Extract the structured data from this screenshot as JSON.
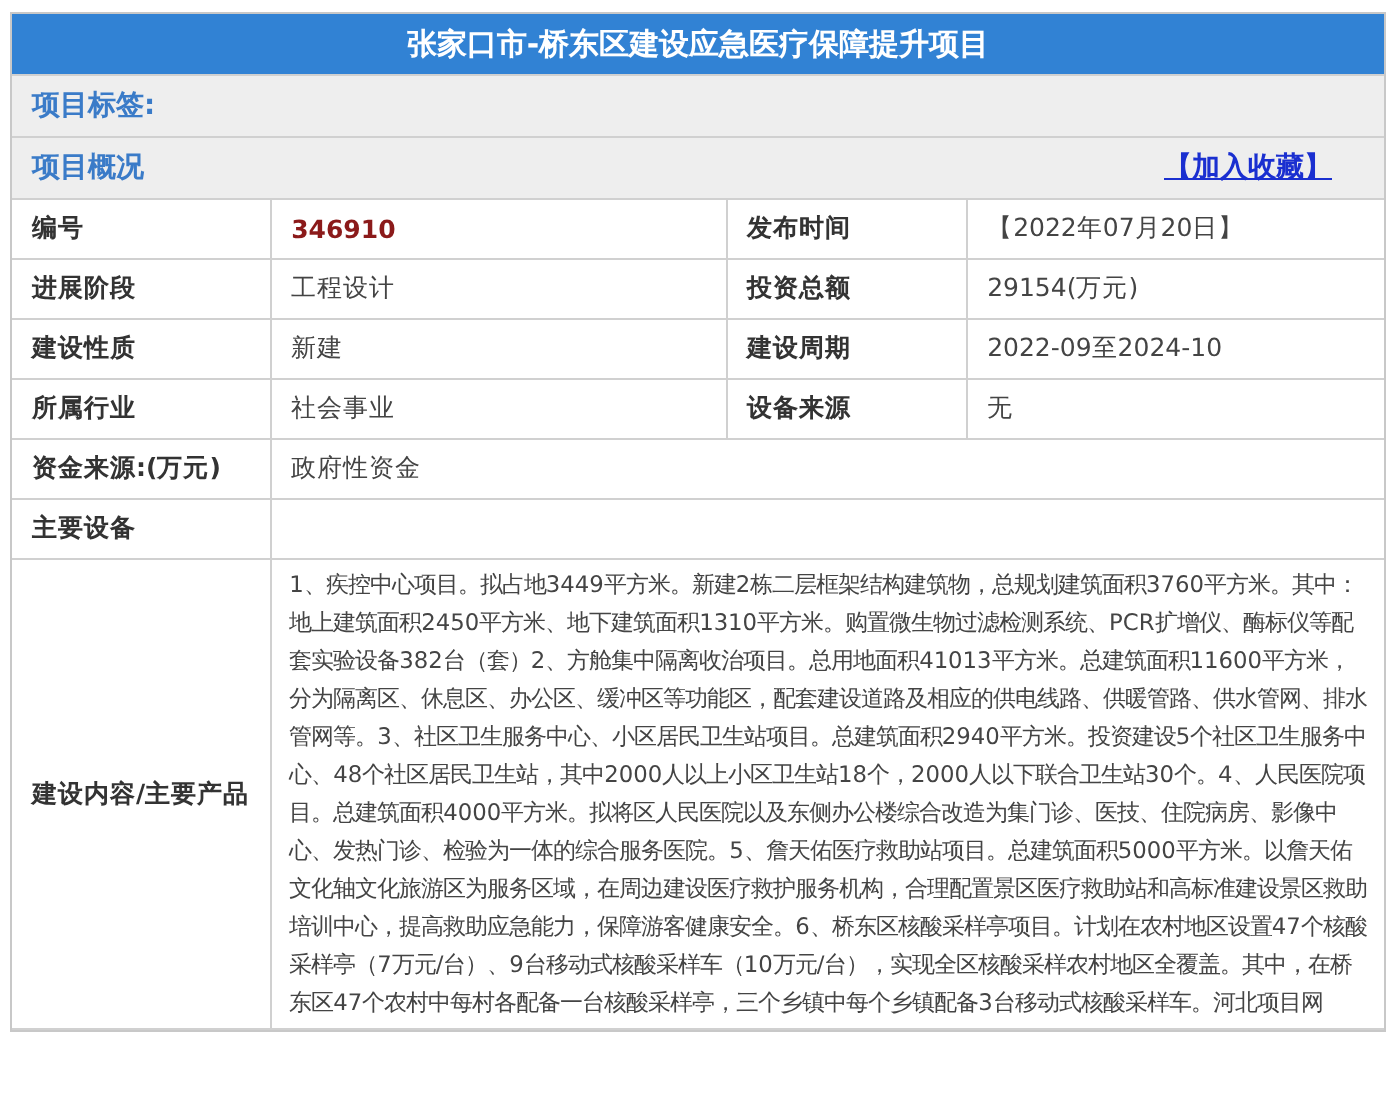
{
  "title": "张家口市-桥东区建设应急医疗保障提升项目",
  "tags_label": "项目标签:",
  "overview": {
    "label": "项目概况",
    "favorite_link": "【加入收藏】"
  },
  "rows": [
    {
      "cells": [
        {
          "label": "编号",
          "value": "346910",
          "highlight": true
        },
        {
          "label": "发布时间",
          "value": "【2022年07月20日】",
          "highlight": false
        }
      ]
    },
    {
      "cells": [
        {
          "label": "进展阶段",
          "value": "工程设计",
          "highlight": false
        },
        {
          "label": "投资总额",
          "value": "29154(万元)",
          "highlight": false
        }
      ]
    },
    {
      "cells": [
        {
          "label": "建设性质",
          "value": "新建",
          "highlight": false
        },
        {
          "label": "建设周期",
          "value": "2022-09至2024-10",
          "highlight": false
        }
      ]
    },
    {
      "cells": [
        {
          "label": "所属行业",
          "value": "社会事业",
          "highlight": false
        },
        {
          "label": "设备来源",
          "value": "无",
          "highlight": false
        }
      ]
    },
    {
      "cells": [
        {
          "label": "资金来源:(万元)",
          "value": "政府性资金",
          "highlight": false
        }
      ]
    },
    {
      "cells": [
        {
          "label": "主要设备"
        }
      ]
    },
    {
      "cells": [
        {
          "label": "建设内容/主要产品",
          "value": "1、疾控中心项目。拟占地3449平方米。新建2栋二层框架结构建筑物，总规划建筑面积3760平方米。其中：地上建筑面积2450平方米、地下建筑面积1310平方米。购置微生物过滤检测系统、PCR扩增仪、酶标仪等配套实验设备382台（套）2、方舱集中隔离收治项目。总用地面积41013平方米。总建筑面积11600平方米，分为隔离区、休息区、办公区、缓冲区等功能区，配套建设道路及相应的供电线路、供暖管路、供水管网、排水管网等。3、社区卫生服务中心、小区居民卫生站项目。总建筑面积2940平方米。投资建设5个社区卫生服务中心、48个社区居民卫生站，其中2000人以上小区卫生站18个，2000人以下联合卫生站30个。4、人民医院项目。总建筑面积4000平方米。拟将区人民医院以及东侧办公楼综合改造为集门诊、医技、住院病房、影像中心、发热门诊、检验为一体的综合服务医院。5、詹天佑医疗救助站项目。总建筑面积5000平方米。以詹天佑文化轴文化旅游区为服务区域，在周边建设医疗救护服务机构，合理配置景区医疗救助站和高标准建设景区救助培训中心，提高救助应急能力，保障游客健康安全。6、桥东区核酸采样亭项目。计划在农村地区设置47个核酸采样亭（7万元/台）、9台移动式核酸采样车（10万元/台），实现全区核酸采样农村地区全覆盖。其中，在桥东区47个农村中每村各配备一台核酸采样亭，三个乡镇中每个乡镇配备3台移动式核酸采样车。河北项目网",
          "highlight": false
        }
      ]
    }
  ]
}
